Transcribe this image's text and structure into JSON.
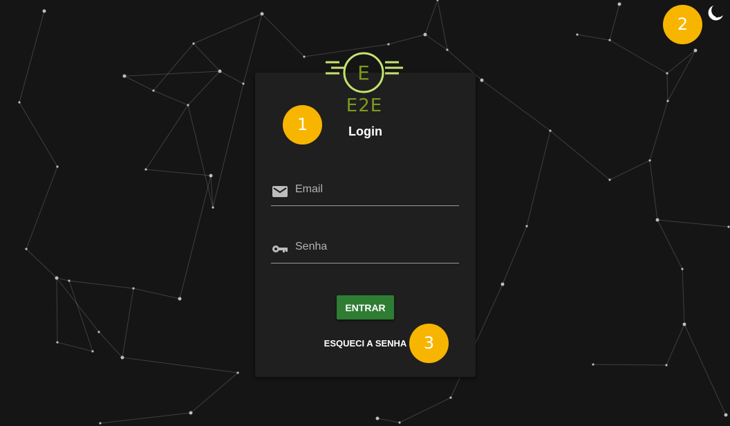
{
  "logo": {
    "icon": "e2e-logo-icon",
    "letter": "E",
    "brand_name": "E2E",
    "accent_color": "#7d9a1f",
    "ring_color": "#c5e36f"
  },
  "login": {
    "title": "Login",
    "email": {
      "placeholder": "Email",
      "value": "",
      "icon": "email-icon"
    },
    "password": {
      "placeholder": "Senha",
      "value": "",
      "icon": "key-icon"
    },
    "submit_label": "ENTRAR",
    "forgot_label": "ESQUECI A SENHA",
    "submit_color": "#2e7d32"
  },
  "header": {
    "theme_toggle_icon": "dark-mode-moon-icon"
  },
  "annotations": {
    "color": "#f7b500",
    "items": [
      {
        "label": "1"
      },
      {
        "label": "2"
      },
      {
        "label": "3"
      }
    ]
  },
  "background": {
    "color": "#151515",
    "pattern": "network-particles"
  }
}
